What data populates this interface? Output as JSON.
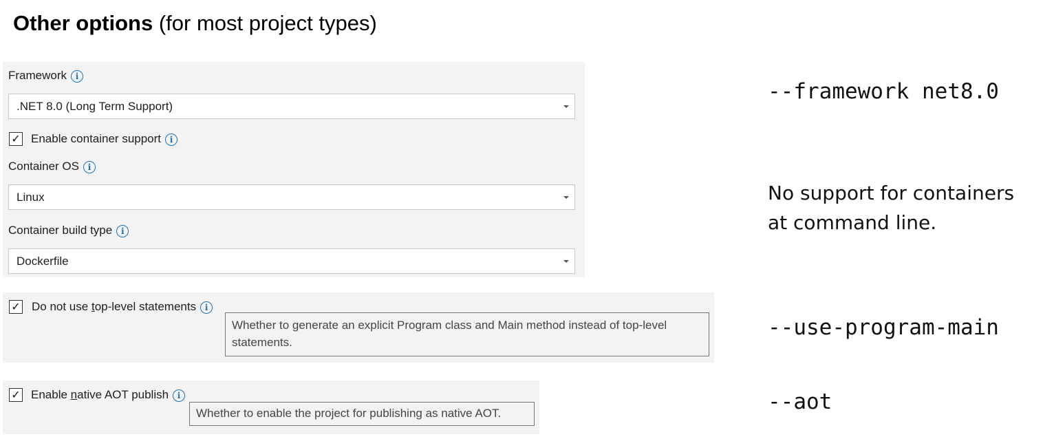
{
  "title": {
    "bold": "Other options",
    "rest": " (for most project types)"
  },
  "framework": {
    "label": "Framework",
    "value": ".NET 8.0 (Long Term Support)"
  },
  "container_support": {
    "label": "Enable container support",
    "checked": true
  },
  "container_os": {
    "label": "Container OS",
    "value": "Linux"
  },
  "container_build_type": {
    "label": "Container build type",
    "value": "Dockerfile"
  },
  "top_level": {
    "label_pre": "Do not use ",
    "label_accel": "t",
    "label_post": "op-level statements",
    "checked": true,
    "tooltip_line1": "Whether to generate an explicit Program class and Main method instead of top-level",
    "tooltip_line2": "statements."
  },
  "native_aot": {
    "label_pre": "Enable ",
    "label_accel": "n",
    "label_post": "ative AOT publish",
    "checked": true,
    "tooltip": "Whether to enable the project for publishing as native AOT."
  },
  "notes": {
    "framework_cli": "--framework net8.0",
    "containers_line1": "No support for containers",
    "containers_line2": "at command line.",
    "top_level_cli": "--use-program-main",
    "aot_cli": "--aot"
  },
  "icons": {
    "info": "info-icon",
    "check": "checkmark-icon",
    "dropdown": "chevron-down-icon"
  },
  "colors": {
    "panel_bg": "#f3f3f3",
    "info_blue": "#1a73b8"
  }
}
